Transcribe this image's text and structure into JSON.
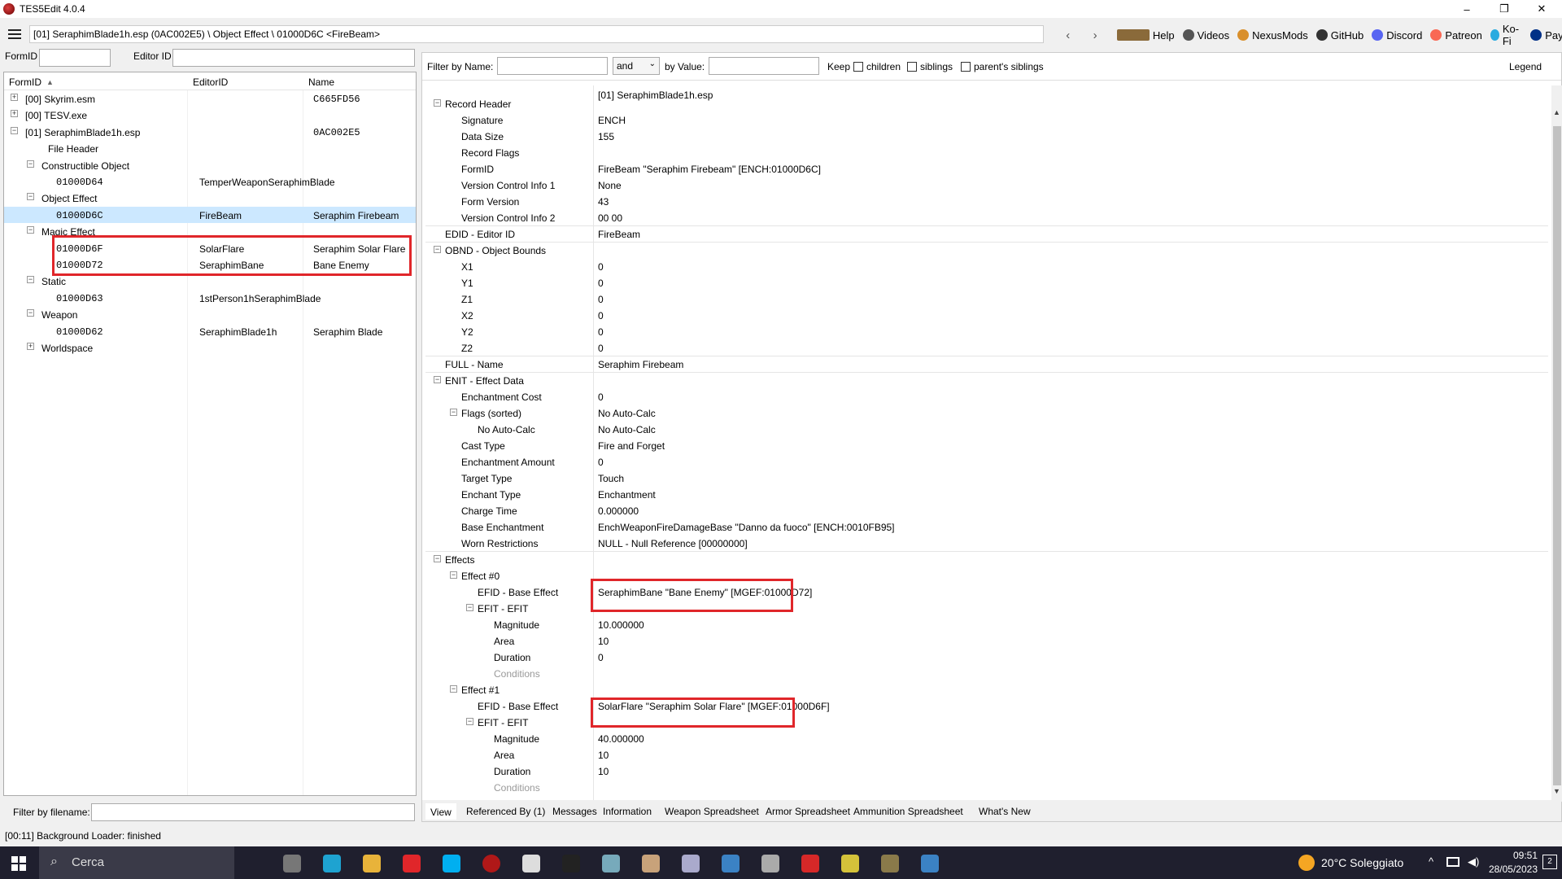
{
  "titlebar": {
    "title": "TES5Edit 4.0.4",
    "minimize": "–",
    "maximize": "❐",
    "close": "✕"
  },
  "pathbar": {
    "path": "[01] SeraphimBlade1h.esp (0AC002E5) \\ Object Effect \\ 01000D6C <FireBeam>",
    "back": "‹",
    "forward": "›",
    "links": [
      {
        "label": "Help",
        "icon": "book-icon",
        "color": "#8a6a3a"
      },
      {
        "label": "Videos",
        "icon": "videos-icon",
        "color": "#555555"
      },
      {
        "label": "NexusMods",
        "icon": "nexusmods-icon",
        "color": "#d98f2b"
      },
      {
        "label": "GitHub",
        "icon": "github-icon",
        "color": "#333333"
      },
      {
        "label": "Discord",
        "icon": "discord-icon",
        "color": "#5865f2"
      },
      {
        "label": "Patreon",
        "icon": "patreon-icon",
        "color": "#f96854"
      },
      {
        "label": "Ko-Fi",
        "icon": "kofi-icon",
        "color": "#29abe0"
      },
      {
        "label": "PayPal",
        "icon": "paypal-icon",
        "color": "#003087"
      }
    ]
  },
  "left_filters": {
    "formid_label": "FormID",
    "editorid_label": "Editor ID"
  },
  "tree": {
    "columns": [
      "FormID",
      "EditorID",
      "Name"
    ],
    "rows": [
      {
        "formid": "[00] Skyrim.esm",
        "editorid": "",
        "name": "C665FD56",
        "expander": "+"
      },
      {
        "formid": "[00] TESV.exe",
        "editorid": "",
        "name": "",
        "expander": "+"
      },
      {
        "formid": "[01] SeraphimBlade1h.esp",
        "editorid": "",
        "name": "0AC002E5",
        "expander": "−"
      },
      {
        "formid": "File Header",
        "editorid": "",
        "name": "",
        "expander": ""
      },
      {
        "formid": "Constructible Object",
        "editorid": "",
        "name": "",
        "expander": "−"
      },
      {
        "formid": "01000D64",
        "editorid": "TemperWeaponSeraphimBlade",
        "name": "",
        "expander": ""
      },
      {
        "formid": "Object Effect",
        "editorid": "",
        "name": "",
        "expander": "−"
      },
      {
        "formid": "01000D6C",
        "editorid": "FireBeam",
        "name": "Seraphim Firebeam",
        "expander": ""
      },
      {
        "formid": "Magic Effect",
        "editorid": "",
        "name": "",
        "expander": "−"
      },
      {
        "formid": "01000D6F",
        "editorid": "SolarFlare",
        "name": "Seraphim Solar Flare",
        "expander": ""
      },
      {
        "formid": "01000D72",
        "editorid": "SeraphimBane",
        "name": "Bane Enemy",
        "expander": ""
      },
      {
        "formid": "Static",
        "editorid": "",
        "name": "",
        "expander": "−"
      },
      {
        "formid": "01000D63",
        "editorid": "1stPerson1hSeraphimBlade",
        "name": "",
        "expander": ""
      },
      {
        "formid": "Weapon",
        "editorid": "",
        "name": "",
        "expander": "−"
      },
      {
        "formid": "01000D62",
        "editorid": "SeraphimBlade1h",
        "name": "Seraphim Blade",
        "expander": ""
      },
      {
        "formid": "Worldspace",
        "editorid": "",
        "name": "",
        "expander": "+"
      }
    ],
    "filter_label": "Filter by filename:"
  },
  "right_filter": {
    "by_name": "Filter by Name:",
    "logic": "and",
    "by_value": "by Value:",
    "keep": "Keep",
    "children": "children",
    "siblings": "siblings",
    "parents": "parent's siblings",
    "legend": "Legend"
  },
  "record": {
    "file": "[01] SeraphimBlade1h.esp",
    "rows": [
      {
        "key": "Record Header",
        "value": "",
        "exp": "−"
      },
      {
        "key": "Signature",
        "value": "ENCH",
        "exp": ""
      },
      {
        "key": "Data Size",
        "value": "155",
        "exp": ""
      },
      {
        "key": "Record Flags",
        "value": "",
        "exp": ""
      },
      {
        "key": "FormID",
        "value": "FireBeam \"Seraphim Firebeam\" [ENCH:01000D6C]",
        "exp": ""
      },
      {
        "key": "Version Control Info 1",
        "value": "None",
        "exp": ""
      },
      {
        "key": "Form Version",
        "value": "43",
        "exp": ""
      },
      {
        "key": "Version Control Info 2",
        "value": "00 00",
        "exp": ""
      },
      {
        "key": "EDID - Editor ID",
        "value": "FireBeam",
        "exp": ""
      },
      {
        "key": "OBND - Object Bounds",
        "value": "",
        "exp": "−"
      },
      {
        "key": "X1",
        "value": "0",
        "exp": ""
      },
      {
        "key": "Y1",
        "value": "0",
        "exp": ""
      },
      {
        "key": "Z1",
        "value": "0",
        "exp": ""
      },
      {
        "key": "X2",
        "value": "0",
        "exp": ""
      },
      {
        "key": "Y2",
        "value": "0",
        "exp": ""
      },
      {
        "key": "Z2",
        "value": "0",
        "exp": ""
      },
      {
        "key": "FULL - Name",
        "value": "Seraphim Firebeam",
        "exp": ""
      },
      {
        "key": "ENIT - Effect Data",
        "value": "",
        "exp": "−"
      },
      {
        "key": "Enchantment Cost",
        "value": "0",
        "exp": ""
      },
      {
        "key": "Flags (sorted)",
        "value": "No Auto-Calc",
        "exp": "−"
      },
      {
        "key": "No Auto-Calc",
        "value": "No Auto-Calc",
        "exp": ""
      },
      {
        "key": "Cast Type",
        "value": "Fire and Forget",
        "exp": ""
      },
      {
        "key": "Enchantment Amount",
        "value": "0",
        "exp": ""
      },
      {
        "key": "Target Type",
        "value": "Touch",
        "exp": ""
      },
      {
        "key": "Enchant Type",
        "value": "Enchantment",
        "exp": ""
      },
      {
        "key": "Charge Time",
        "value": "0.000000",
        "exp": ""
      },
      {
        "key": "Base Enchantment",
        "value": "EnchWeaponFireDamageBase \"Danno da fuoco\" [ENCH:0010FB95]",
        "exp": ""
      },
      {
        "key": "Worn Restrictions",
        "value": "NULL - Null Reference [00000000]",
        "exp": ""
      },
      {
        "key": "Effects",
        "value": "",
        "exp": "−"
      },
      {
        "key": "Effect #0",
        "value": "",
        "exp": "−"
      },
      {
        "key": "EFID - Base Effect",
        "value": "SeraphimBane \"Bane Enemy\" [MGEF:01000D72]",
        "exp": ""
      },
      {
        "key": "EFIT - EFIT",
        "value": "",
        "exp": "−"
      },
      {
        "key": "Magnitude",
        "value": "10.000000",
        "exp": ""
      },
      {
        "key": "Area",
        "value": "10",
        "exp": ""
      },
      {
        "key": "Duration",
        "value": "0",
        "exp": ""
      },
      {
        "key": "Conditions",
        "value": "",
        "exp": ""
      },
      {
        "key": "Effect #1",
        "value": "",
        "exp": "−"
      },
      {
        "key": "EFID - Base Effect",
        "value": "SolarFlare \"Seraphim Solar Flare\" [MGEF:01000D6F]",
        "exp": ""
      },
      {
        "key": "EFIT - EFIT",
        "value": "",
        "exp": "−"
      },
      {
        "key": "Magnitude",
        "value": "40.000000",
        "exp": ""
      },
      {
        "key": "Area",
        "value": "10",
        "exp": ""
      },
      {
        "key": "Duration",
        "value": "10",
        "exp": ""
      },
      {
        "key": "Conditions",
        "value": "",
        "exp": ""
      }
    ]
  },
  "tabs": [
    "View",
    "Referenced By (1)",
    "Messages",
    "Information",
    "Weapon Spreadsheet",
    "Armor Spreadsheet",
    "Ammunition Spreadsheet",
    "What's New"
  ],
  "status": "[00:11] Background Loader: finished",
  "taskbar": {
    "search": "Cerca",
    "weather": "20°C Soleggiato",
    "time": "09:51",
    "date": "28/05/2023",
    "notifications": "2",
    "apps": [
      "task-view-icon",
      "edge-icon",
      "file-explorer-icon",
      "opera-icon",
      "skype-icon",
      "tes5edit-icon",
      "game-icon",
      "terminal-icon",
      "brush-icon",
      "tool-icon",
      "pen-icon",
      "window-icon",
      "notepad-icon",
      "f-app-icon",
      "app-icon",
      "arrow-app-icon",
      "app2-icon"
    ]
  },
  "accent": {
    "highlight": "#e0262a",
    "selected_row": "#cce8ff"
  }
}
